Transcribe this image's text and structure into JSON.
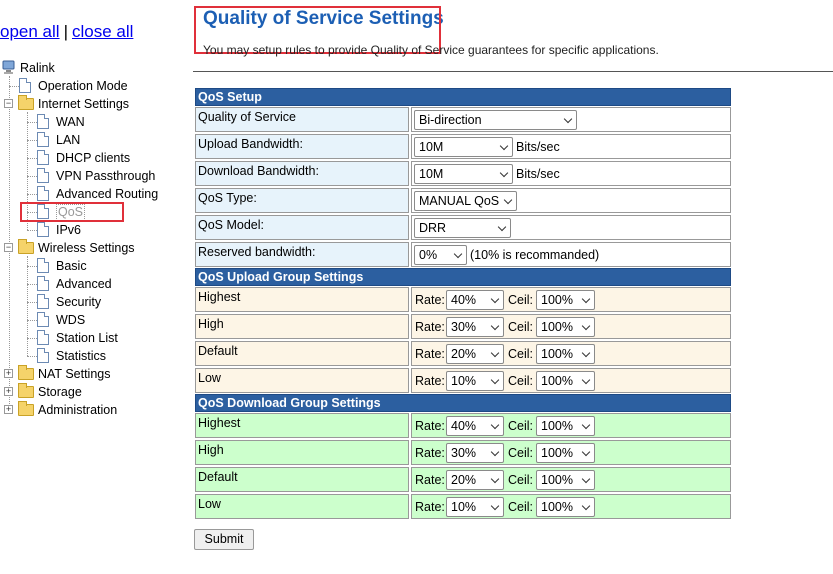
{
  "tree": {
    "open_all": "open all",
    "close_all": "close all",
    "separator": "|",
    "root": "Ralink",
    "items": [
      {
        "label": "Operation Mode"
      },
      {
        "label": "Internet Settings"
      },
      {
        "label": "WAN"
      },
      {
        "label": "LAN"
      },
      {
        "label": "DHCP clients"
      },
      {
        "label": "VPN Passthrough"
      },
      {
        "label": "Advanced Routing"
      },
      {
        "label": "QoS"
      },
      {
        "label": "IPv6"
      },
      {
        "label": "Wireless Settings"
      },
      {
        "label": "Basic"
      },
      {
        "label": "Advanced"
      },
      {
        "label": "Security"
      },
      {
        "label": "WDS"
      },
      {
        "label": "Station List"
      },
      {
        "label": "Statistics"
      },
      {
        "label": "NAT Settings"
      },
      {
        "label": "Storage"
      },
      {
        "label": "Administration"
      }
    ]
  },
  "page": {
    "title": "Quality of Service Settings",
    "subtitle": "You may setup rules to provide Quality of Service guarantees for specific applications."
  },
  "setup": {
    "header": "QoS Setup",
    "qos_label": "Quality of Service",
    "qos_value": "Bi-direction",
    "upload_label": "Upload Bandwidth:",
    "upload_value": "10M",
    "download_label": "Download Bandwidth:",
    "download_value": "10M",
    "unit": "Bits/sec",
    "type_label": "QoS Type:",
    "type_value": "MANUAL QoS",
    "model_label": "QoS Model:",
    "model_value": "DRR",
    "reserved_label": "Reserved bandwidth:",
    "reserved_value": "0%",
    "reserved_note": "(10% is recommanded)"
  },
  "rate_label": "Rate:",
  "ceil_label": "Ceil:",
  "upload_groups": {
    "header": "QoS Upload Group Settings",
    "rows": [
      {
        "name": "Highest",
        "rate": "40%",
        "ceil": "100%"
      },
      {
        "name": "High",
        "rate": "30%",
        "ceil": "100%"
      },
      {
        "name": "Default",
        "rate": "20%",
        "ceil": "100%"
      },
      {
        "name": "Low",
        "rate": "10%",
        "ceil": "100%"
      }
    ]
  },
  "download_groups": {
    "header": "QoS Download Group Settings",
    "rows": [
      {
        "name": "Highest",
        "rate": "40%",
        "ceil": "100%"
      },
      {
        "name": "High",
        "rate": "30%",
        "ceil": "100%"
      },
      {
        "name": "Default",
        "rate": "20%",
        "ceil": "100%"
      },
      {
        "name": "Low",
        "rate": "10%",
        "ceil": "100%"
      }
    ]
  },
  "submit_label": "Submit",
  "colors": {
    "header_bg": "#2c5fa0",
    "title": "#1c5fb4",
    "highlight": "#e0303a",
    "upload_bg": "#fdf5e6",
    "download_bg": "#ccffcc",
    "setup_label_bg": "#e7f3fb"
  }
}
